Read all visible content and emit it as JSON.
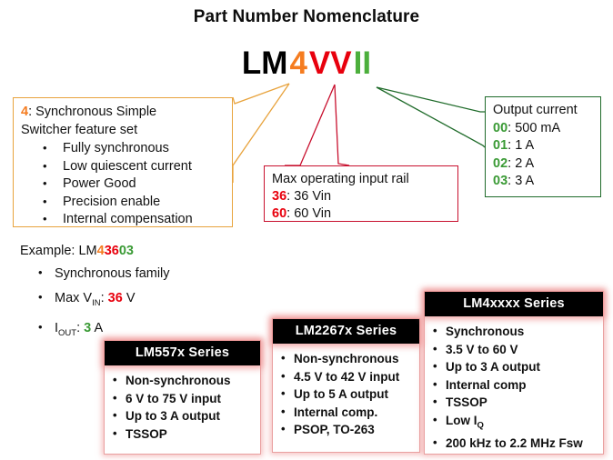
{
  "title": "Part Number Nomenclature",
  "part_number": {
    "prefix": "LM",
    "family_digit": "4",
    "voltage_code": "VV",
    "current_code": "II",
    "colors": {
      "prefix": "#000000",
      "family_digit": "#F57C20",
      "voltage_code": "#E8000D",
      "current_code": "#4CAF3C"
    }
  },
  "feature_box": {
    "key": "4",
    "lead_line1": ": Synchronous  Simple",
    "lead_line2": "Switcher feature set",
    "items": [
      "Fully synchronous",
      "Low quiescent current",
      "Power Good",
      "Precision enable",
      "Internal compensation"
    ],
    "border_color": "#E8A33D"
  },
  "rail_box": {
    "heading": "Max  operating  input rail",
    "rows": [
      {
        "key": "36",
        "value": ": 36 Vin"
      },
      {
        "key": "60",
        "value": ": 60 Vin"
      }
    ],
    "border_color": "#C8102E"
  },
  "current_box": {
    "heading": "Output  current",
    "rows": [
      {
        "key": "00",
        "value": ": 500 mA"
      },
      {
        "key": "01",
        "value": ": 1 A"
      },
      {
        "key": "02",
        "value": ": 2 A"
      },
      {
        "key": "03",
        "value": ": 3 A"
      }
    ],
    "border_color": "#1F6B2A"
  },
  "example": {
    "label": "Example:  LM",
    "part_segments": {
      "family": "4",
      "voltage": "36",
      "current": "03"
    },
    "bullets": {
      "family": "Synchronous  family",
      "vin_prefix": "Max  V",
      "vin_sub": "IN",
      "vin_mid": ": ",
      "vin_value": "36",
      "vin_unit": " V",
      "iout_prefix": "I",
      "iout_sub": "OUT",
      "iout_mid": ": ",
      "iout_value": "3",
      "iout_unit": " A"
    }
  },
  "series_boxes": [
    {
      "title": "LM557x  Series",
      "items": [
        "Non-synchronous",
        "6 V to 75 V input",
        "Up to 3 A output",
        "TSSOP"
      ]
    },
    {
      "title": "LM2267x  Series",
      "items": [
        "Non-synchronous",
        "4.5 V to 42 V input",
        "Up to 5 A output",
        "Internal comp.",
        "PSOP, TO-263"
      ]
    },
    {
      "title": "LM4xxxx  Series",
      "items": [
        "Synchronous",
        "3.5 V to 60 V",
        "Up to 3 A output",
        "Internal comp",
        "TSSOP",
        "Low IQ",
        "200 kHz to 2.2 MHz Fsw"
      ]
    }
  ]
}
